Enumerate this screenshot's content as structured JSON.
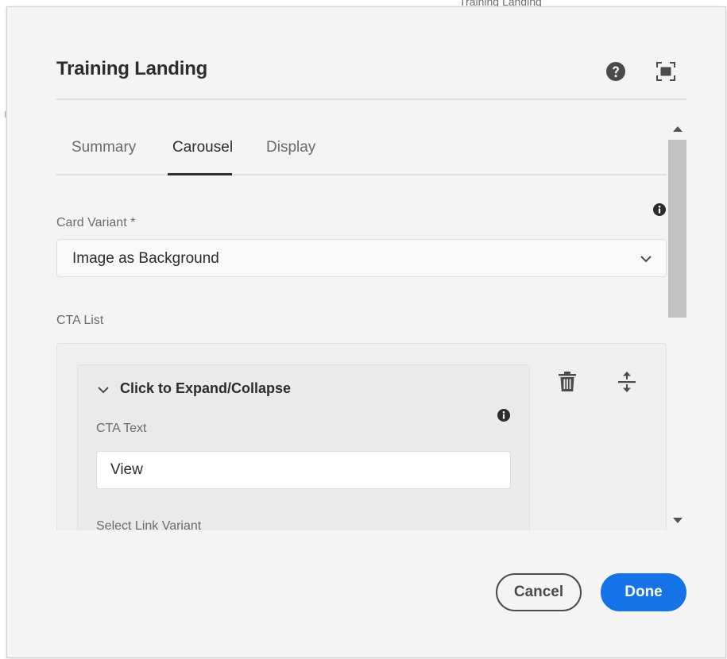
{
  "background": {
    "partial_text": "Training Landing"
  },
  "dialog": {
    "title": "Training Landing",
    "header_icons": [
      "help-icon",
      "fullscreen-icon"
    ]
  },
  "tabs": [
    {
      "label": "Summary",
      "active": false
    },
    {
      "label": "Carousel",
      "active": true
    },
    {
      "label": "Display",
      "active": false
    }
  ],
  "card_variant": {
    "label": "Card Variant *",
    "value": "Image as Background"
  },
  "cta_list": {
    "label": "CTA List",
    "item": {
      "toggle_label": "Click to Expand/Collapse",
      "cta_text_label": "CTA Text",
      "cta_text_value": "View",
      "link_variant_label": "Select Link Variant"
    }
  },
  "footer": {
    "cancel_label": "Cancel",
    "done_label": "Done"
  },
  "colors": {
    "accent": "#1473e6",
    "dialog_background": "#f4f4f4",
    "text": "#2c2c2c",
    "muted_text": "#6b6b6b"
  }
}
